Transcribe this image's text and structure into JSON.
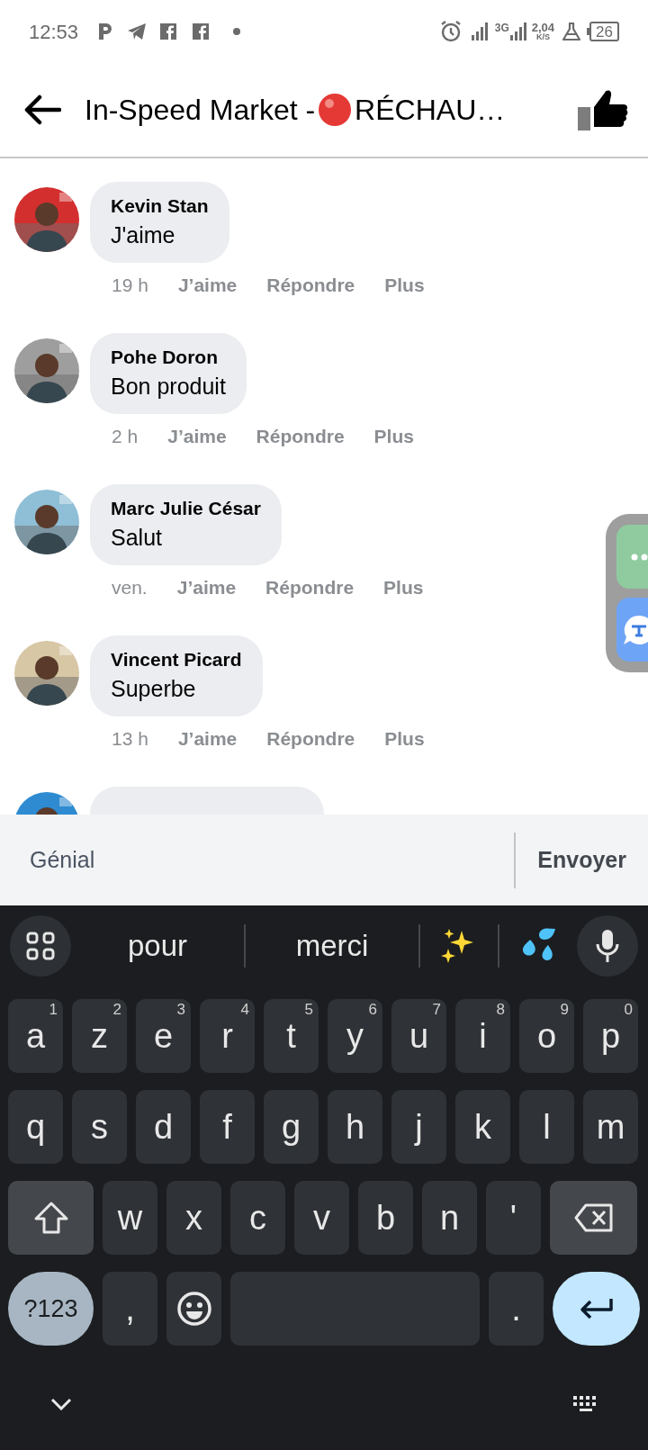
{
  "status_bar": {
    "time": "12:53",
    "network": "3G",
    "speed": "2,04",
    "speed_unit": "K/S",
    "battery": "26"
  },
  "header": {
    "title_before": "In-Speed Market -",
    "title_after": "RÉCHAU…"
  },
  "comments": [
    {
      "name": "Kevin Stan",
      "text": "J'aime",
      "time": "19 h",
      "actions": [
        "J’aime",
        "Répondre",
        "Plus"
      ]
    },
    {
      "name": "Pohe Doron",
      "text": "Bon produit",
      "time": "2 h",
      "actions": [
        "J’aime",
        "Répondre",
        "Plus"
      ]
    },
    {
      "name": "Marc Julie César",
      "text": "Salut",
      "time": "ven.",
      "actions": [
        "J’aime",
        "Répondre",
        "Plus"
      ]
    },
    {
      "name": "Vincent Picard",
      "text": "Superbe",
      "time": "13 h",
      "actions": [
        "J’aime",
        "Répondre",
        "Plus"
      ]
    }
  ],
  "more_comments_below": true,
  "composer": {
    "value": "Génial",
    "send": "Envoyer"
  },
  "keyboard": {
    "suggestions": [
      "pour",
      "merci"
    ],
    "rows": [
      [
        {
          "kind": "letter",
          "label": "a",
          "hint": "1"
        },
        {
          "kind": "letter",
          "label": "z",
          "hint": "2"
        },
        {
          "kind": "letter",
          "label": "e",
          "hint": "3"
        },
        {
          "kind": "letter",
          "label": "r",
          "hint": "4"
        },
        {
          "kind": "letter",
          "label": "t",
          "hint": "5"
        },
        {
          "kind": "letter",
          "label": "y",
          "hint": "6"
        },
        {
          "kind": "letter",
          "label": "u",
          "hint": "7"
        },
        {
          "kind": "letter",
          "label": "i",
          "hint": "8"
        },
        {
          "kind": "letter",
          "label": "o",
          "hint": "9"
        },
        {
          "kind": "letter",
          "label": "p",
          "hint": "0"
        }
      ],
      [
        {
          "kind": "letter",
          "label": "q"
        },
        {
          "kind": "letter",
          "label": "s"
        },
        {
          "kind": "letter",
          "label": "d"
        },
        {
          "kind": "letter",
          "label": "f"
        },
        {
          "kind": "letter",
          "label": "g"
        },
        {
          "kind": "letter",
          "label": "h"
        },
        {
          "kind": "letter",
          "label": "j"
        },
        {
          "kind": "letter",
          "label": "k"
        },
        {
          "kind": "letter",
          "label": "l"
        },
        {
          "kind": "letter",
          "label": "m"
        }
      ],
      [
        {
          "kind": "shift"
        },
        {
          "kind": "letter",
          "label": "w"
        },
        {
          "kind": "letter",
          "label": "x"
        },
        {
          "kind": "letter",
          "label": "c"
        },
        {
          "kind": "letter",
          "label": "v"
        },
        {
          "kind": "letter",
          "label": "b"
        },
        {
          "kind": "letter",
          "label": "n"
        },
        {
          "kind": "letter",
          "label": "'"
        },
        {
          "kind": "backspace"
        }
      ],
      [
        {
          "kind": "symbols",
          "label": "?123"
        },
        {
          "kind": "letter",
          "label": ","
        },
        {
          "kind": "emoji"
        },
        {
          "kind": "space"
        },
        {
          "kind": "letter",
          "label": "."
        },
        {
          "kind": "enter"
        }
      ]
    ]
  }
}
